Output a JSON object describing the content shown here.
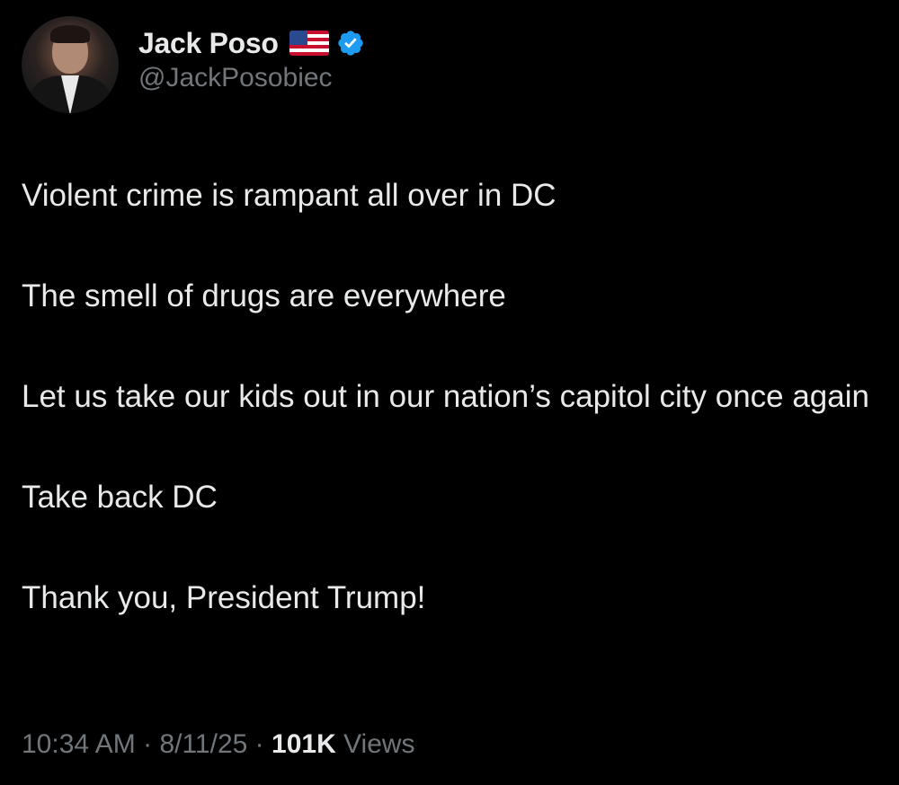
{
  "author": {
    "display_name": "Jack Poso",
    "handle": "@JackPosobiec",
    "flag_icon": "us-flag-icon",
    "verified_icon": "verified-badge-icon",
    "verified_color": "#1d9bf0"
  },
  "tweet": {
    "paragraphs": [
      "Violent crime is rampant all over in DC",
      "The smell of drugs are everywhere",
      "Let us take our kids out in our nation’s capitol city once again",
      "Take back DC",
      "Thank you, President Trump!"
    ]
  },
  "meta": {
    "time": "10:34 AM",
    "separator": "·",
    "date": "8/11/25",
    "views_count": "101K",
    "views_label": "Views"
  },
  "colors": {
    "background": "#000000",
    "text": "#e7e9ea",
    "secondary": "#71767b"
  }
}
